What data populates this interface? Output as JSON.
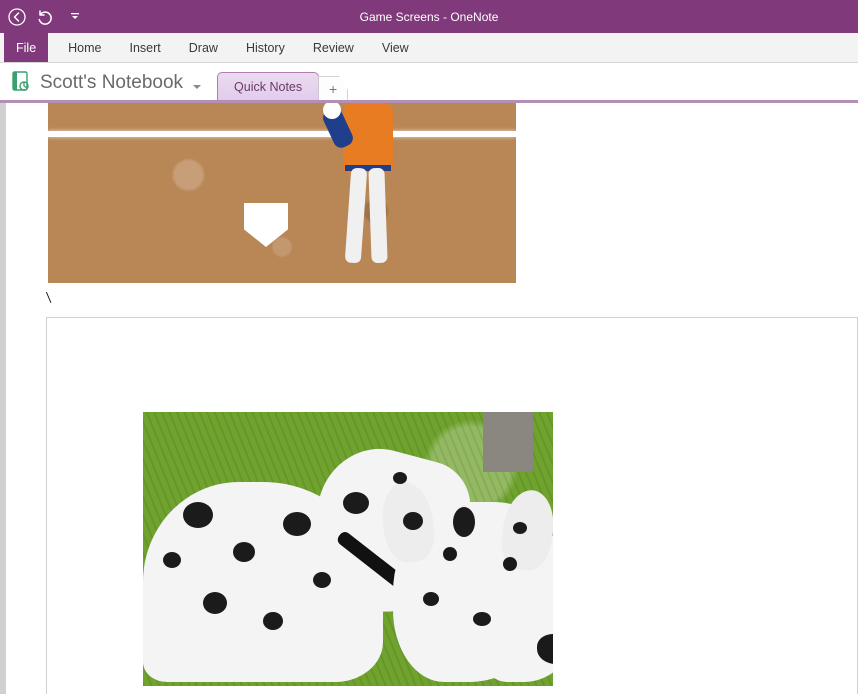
{
  "window": {
    "document_title": "Game Screens",
    "separator": "  -  ",
    "app_name": "OneNote"
  },
  "ribbon": {
    "file": "File",
    "tabs": [
      "Home",
      "Insert",
      "Draw",
      "History",
      "Review",
      "View"
    ]
  },
  "notebook": {
    "name": "Scott's Notebook"
  },
  "sections": {
    "active": "Quick Notes",
    "add_label": "+"
  },
  "page": {
    "stray_text": "\\"
  }
}
